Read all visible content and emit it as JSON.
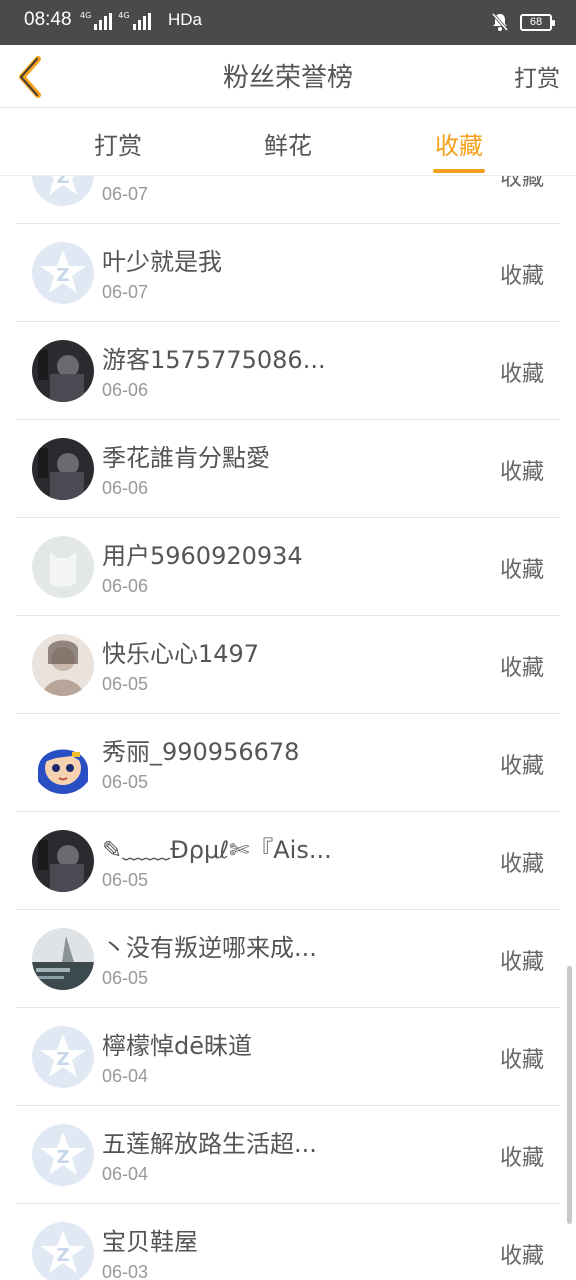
{
  "status_bar": {
    "time": "08:48",
    "network_a": "4G",
    "network_b": "4G",
    "hd_label": "HDa",
    "battery": "68"
  },
  "header": {
    "title": "粉丝荣誉榜",
    "right_action": "打赏"
  },
  "tabs": [
    {
      "label": "打赏",
      "active": false
    },
    {
      "label": "鲜花",
      "active": false
    },
    {
      "label": "收藏",
      "active": true
    }
  ],
  "accent_color": "#f5a01a",
  "rows": [
    {
      "name": "",
      "date": "06-07",
      "action": "收藏",
      "avatar": "default-star"
    },
    {
      "name": "叶少就是我",
      "date": "06-07",
      "action": "收藏",
      "avatar": "default-star"
    },
    {
      "name": "游客1575775086...",
      "date": "06-06",
      "action": "收藏",
      "avatar": "photo-dark"
    },
    {
      "name": "季花誰肯分點愛",
      "date": "06-06",
      "action": "收藏",
      "avatar": "photo-dark"
    },
    {
      "name": "用户5960920934",
      "date": "06-06",
      "action": "收藏",
      "avatar": "placeholder-gray"
    },
    {
      "name": "快乐心心1497",
      "date": "06-05",
      "action": "收藏",
      "avatar": "photo-light"
    },
    {
      "name": "秀丽_990956678",
      "date": "06-05",
      "action": "收藏",
      "avatar": "cartoon-girl"
    },
    {
      "name": "✎﹏﹏Ɖρμℓ✄『Ais...",
      "date": "06-05",
      "action": "收藏",
      "avatar": "photo-dark"
    },
    {
      "name": "丶没有叛逆哪来成...",
      "date": "06-05",
      "action": "收藏",
      "avatar": "photo-landscape"
    },
    {
      "name": "檸檬悼dē昧道",
      "date": "06-04",
      "action": "收藏",
      "avatar": "default-star"
    },
    {
      "name": "五莲解放路生活超...",
      "date": "06-04",
      "action": "收藏",
      "avatar": "default-star"
    },
    {
      "name": "宝贝鞋屋",
      "date": "06-03",
      "action": "收藏",
      "avatar": "default-star"
    }
  ]
}
